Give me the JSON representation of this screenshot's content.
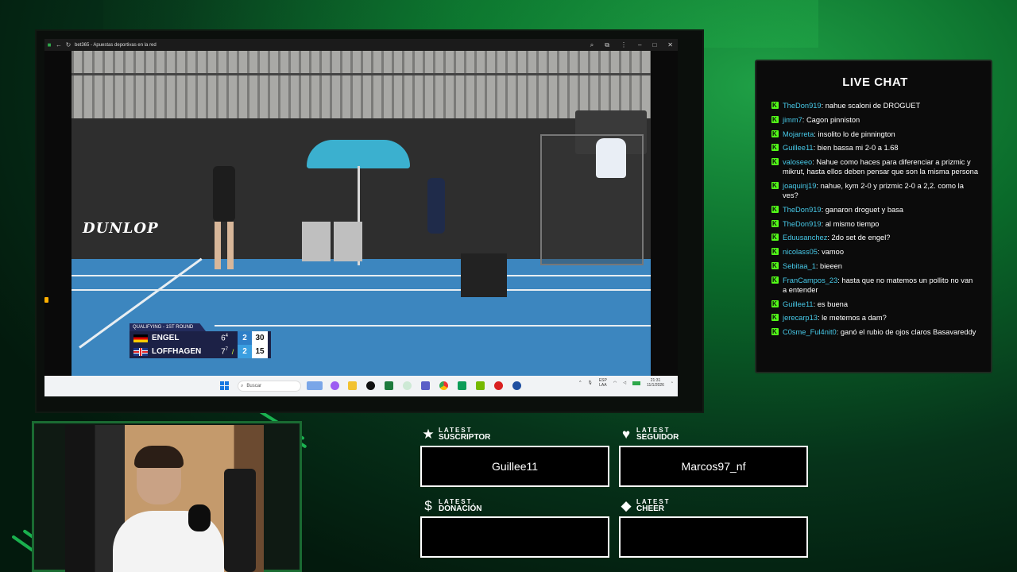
{
  "browser": {
    "title": "bet365 - Apuestas deportivas en la red"
  },
  "video": {
    "sponsor": "DUNLOP",
    "score": {
      "round": "QUALIFYING - 1ST ROUND",
      "players": [
        {
          "name": "ENGEL",
          "set1": "6",
          "set1_tb": "4",
          "games": "2",
          "points": "30",
          "serving": false
        },
        {
          "name": "LOFFHAGEN",
          "set1": "7",
          "set1_tb": "7",
          "games": "2",
          "points": "15",
          "serving": true
        }
      ]
    }
  },
  "taskbar": {
    "search_placeholder": "Buscar",
    "lang_top": "ESP",
    "lang_bottom": "LAA",
    "time": "21:31",
    "date": "11/1/2026"
  },
  "chat": {
    "title": "LIVE CHAT",
    "messages": [
      {
        "user": "TheDon919",
        "text": "nahue scaloni de DROGUET"
      },
      {
        "user": "jimm7",
        "text": "Cagon pinniston"
      },
      {
        "user": "Mojarreta",
        "text": "insolito lo de pinnington"
      },
      {
        "user": "Guillee11",
        "text": "bien bassa mi 2-0 a 1.68"
      },
      {
        "user": "valoseeo",
        "text": "Nahue como haces para diferenciar a prizmic y mikrut, hasta ellos deben pensar que son la misma persona"
      },
      {
        "user": "joaquinj19",
        "text": "nahue, kym 2-0 y prizmic 2-0 a 2,2. como la ves?"
      },
      {
        "user": "TheDon919",
        "text": "ganaron droguet y basa"
      },
      {
        "user": "TheDon919",
        "text": "al mismo tiempo"
      },
      {
        "user": "Eduusanchez",
        "text": "2do set de engel?"
      },
      {
        "user": "nicolass05",
        "text": "vamoo"
      },
      {
        "user": "Sebitaa_1",
        "text": "bieeen"
      },
      {
        "user": "FranCampos_23",
        "text": "hasta que no matemos un pollito no van a entender"
      },
      {
        "user": "Guillee11",
        "text": "es buena"
      },
      {
        "user": "jerecarp13",
        "text": "le metemos a dam?"
      },
      {
        "user": "C0sme_Ful4nit0",
        "text": "ganó el rubio de ojos claros Basavareddy"
      }
    ]
  },
  "latest": {
    "suscriptor": {
      "small": "LATEST",
      "big": "SUSCRIPTOR",
      "value": "Guillee11",
      "icon": "star-icon"
    },
    "seguidor": {
      "small": "LATEST",
      "big": "SEGUIDOR",
      "value": "Marcos97_nf",
      "icon": "heart-icon"
    },
    "donacion": {
      "small": "LATEST",
      "big": "DONACIÓN",
      "value": "",
      "icon": "dollar-icon"
    },
    "cheer": {
      "small": "LATEST",
      "big": "CHEER",
      "value": "",
      "icon": "diamond-icon"
    }
  },
  "colors": {
    "accent_green": "#1ecb5a",
    "chat_username": "#47c9e8",
    "kick_green": "#53fc18"
  }
}
